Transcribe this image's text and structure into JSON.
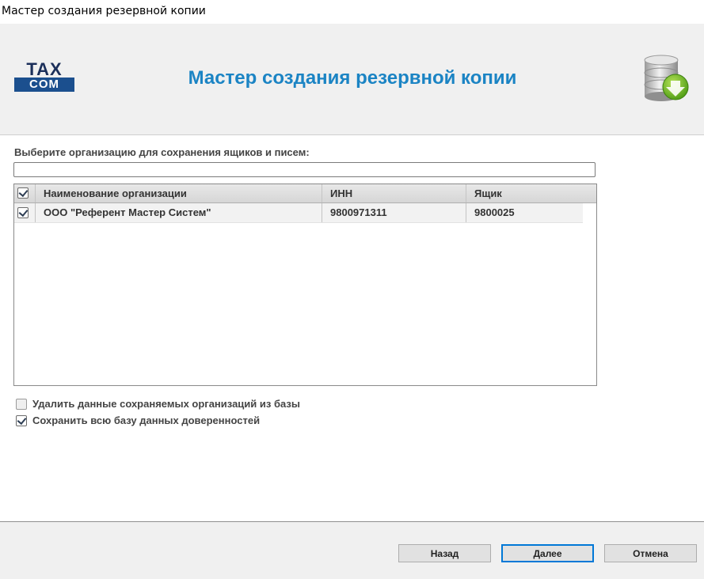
{
  "window": {
    "title": "Мастер создания резервной копии"
  },
  "header": {
    "title": "Мастер создания резервной копии",
    "logo": {
      "line1": "TAX",
      "line2": "COM"
    },
    "icon": "database-download-icon"
  },
  "main": {
    "prompt": "Выберите организацию для сохранения ящиков и писем:",
    "search": {
      "value": "",
      "placeholder": ""
    },
    "table": {
      "select_all_checked": true,
      "columns": [
        "Наименование организации",
        "ИНН",
        "Ящик"
      ],
      "rows": [
        {
          "checked": true,
          "name": "ООО \"Референт Мастер Систем\"",
          "inn": "9800971311",
          "box": "9800025"
        }
      ]
    },
    "options": [
      {
        "label": "Удалить данные сохраняемых организаций из базы",
        "checked": false
      },
      {
        "label": "Сохранить всю базу данных доверенностей",
        "checked": true
      }
    ]
  },
  "footer": {
    "back_label": "Назад",
    "next_label": "Далее",
    "cancel_label": "Отмена"
  },
  "colors": {
    "accent": "#1b84c4",
    "logo_blue": "#1b4f8e",
    "default_button_border": "#0078d7"
  }
}
